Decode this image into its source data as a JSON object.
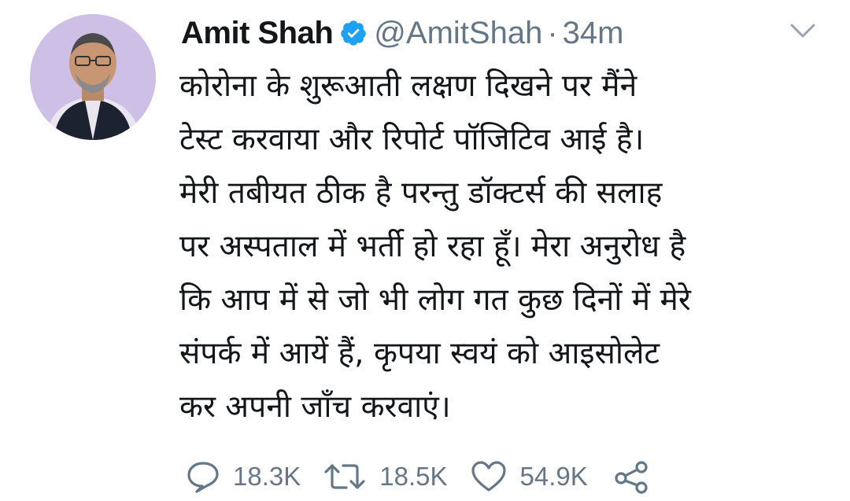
{
  "author": {
    "name": "Amit Shah",
    "handle": "@AmitShah",
    "separator": "·",
    "time": "34m",
    "verified": true
  },
  "tweet": {
    "lines": [
      "कोरोना के शुरूआती लक्षण दिखने पर मैंने",
      "टेस्ट करवाया और रिपोर्ट पॉजिटिव आई है।",
      "मेरी तबीयत ठीक है परन्तु डॉक्टर्स की सलाह",
      "पर अस्पताल में भर्ती हो रहा हूँ। मेरा अनुरोध है",
      "कि आप में से जो भी लोग गत कुछ दिनों में मेरे",
      "संपर्क में आयें हैं, कृपया स्वयं को आइसोलेट",
      "कर अपनी जाँच करवाएं।"
    ]
  },
  "actions": {
    "replies": "18.3K",
    "retweets": "18.5K",
    "likes": "54.9K"
  },
  "icons": {
    "verified": "verified-badge-icon",
    "caret": "chevron-down-icon",
    "reply": "reply-bubble-icon",
    "retweet": "retweet-icon",
    "like": "heart-icon",
    "share": "share-icon"
  },
  "colors": {
    "text": "#14171a",
    "secondary": "#657786",
    "verified": "#1da1f2"
  }
}
